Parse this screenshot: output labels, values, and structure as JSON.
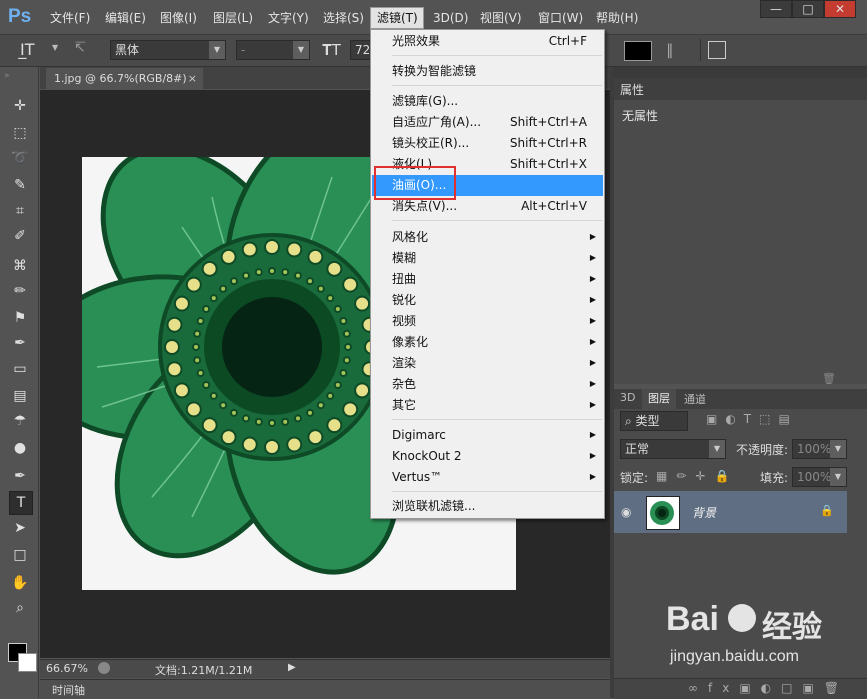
{
  "app": {
    "logo": "Ps"
  },
  "menubar": {
    "items": [
      "文件(F)",
      "编辑(E)",
      "图像(I)",
      "图层(L)",
      "文字(Y)",
      "选择(S)",
      "滤镜(T)",
      "3D(D)",
      "视图(V)",
      "窗口(W)",
      "帮助(H)"
    ],
    "active": "滤镜(T)"
  },
  "window_controls": {
    "minimize": "—",
    "maximize": "□",
    "close": "✕"
  },
  "options_bar": {
    "tool_icon": "type-tool-icon",
    "font_family": "黑体",
    "font_style": "-",
    "font_size": "72"
  },
  "document": {
    "tab_title": "1.jpg @ 66.7%(RGB/8#)",
    "tab_close": "×"
  },
  "status": {
    "zoom": "66.67%",
    "doc_info": "文档:1.21M/1.21M"
  },
  "timeline": {
    "label": "时间轴"
  },
  "properties": {
    "tab": "属性",
    "content": "无属性"
  },
  "layers_panel": {
    "tabs": [
      "3D",
      "图层",
      "通道"
    ],
    "active_tab": "图层",
    "filter_kind": "类型",
    "blend_mode": "正常",
    "opacity_label": "不透明度:",
    "opacity_value": "100%",
    "lock_label": "锁定:",
    "fill_label": "填充:",
    "fill_value": "100%",
    "layer_name": "背景"
  },
  "filter_menu": {
    "items": [
      {
        "label": "光照效果",
        "shortcut": "Ctrl+F"
      },
      {
        "label": "转换为智能滤镜",
        "shortcut": ""
      },
      {
        "label": "滤镜库(G)...",
        "shortcut": ""
      },
      {
        "label": "自适应广角(A)...",
        "shortcut": "Shift+Ctrl+A"
      },
      {
        "label": "镜头校正(R)...",
        "shortcut": "Shift+Ctrl+R"
      },
      {
        "label": "液化(L)...",
        "shortcut": "Shift+Ctrl+X"
      },
      {
        "label": "油画(O)...",
        "shortcut": ""
      },
      {
        "label": "消失点(V)...",
        "shortcut": "Alt+Ctrl+V"
      },
      {
        "label": "风格化",
        "shortcut": ""
      },
      {
        "label": "模糊",
        "shortcut": ""
      },
      {
        "label": "扭曲",
        "shortcut": ""
      },
      {
        "label": "锐化",
        "shortcut": ""
      },
      {
        "label": "视频",
        "shortcut": ""
      },
      {
        "label": "像素化",
        "shortcut": ""
      },
      {
        "label": "渲染",
        "shortcut": ""
      },
      {
        "label": "杂色",
        "shortcut": ""
      },
      {
        "label": "其它",
        "shortcut": ""
      },
      {
        "label": "Digimarc",
        "shortcut": ""
      },
      {
        "label": "KnockOut 2",
        "shortcut": ""
      },
      {
        "label": "Vertus™",
        "shortcut": ""
      },
      {
        "label": "浏览联机滤镜...",
        "shortcut": ""
      }
    ],
    "highlighted": "油画(O)..."
  },
  "watermark": {
    "brand": "Bai",
    "brand_cn": "经验",
    "url": "jingyan.baidu.com"
  },
  "colors": {
    "accent_highlight": "#3399ff",
    "callout_red": "#e0302f",
    "petal_green": "#2a8f55"
  }
}
